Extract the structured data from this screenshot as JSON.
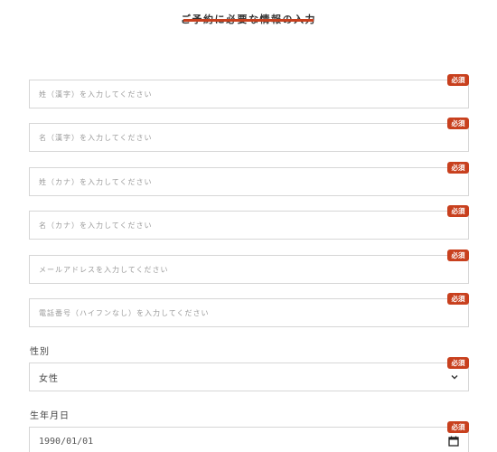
{
  "header": {
    "title": "ご予約に必要な情報の入力"
  },
  "required_badge": "必須",
  "fields": [
    {
      "placeholder": "姓（漢字）を入力してください"
    },
    {
      "placeholder": "名（漢字）を入力してください"
    },
    {
      "placeholder": "姓（カナ）を入力してください"
    },
    {
      "placeholder": "名（カナ）を入力してください"
    },
    {
      "placeholder": "メールアドレスを入力してください"
    },
    {
      "placeholder": "電話番号（ハイフンなし）を入力してください"
    }
  ],
  "gender": {
    "label": "性別",
    "value": "女性"
  },
  "birthdate": {
    "label": "生年月日",
    "value": "1990/01/01"
  },
  "colors": {
    "accent": "#c8401e",
    "border": "#d6d6d6"
  }
}
